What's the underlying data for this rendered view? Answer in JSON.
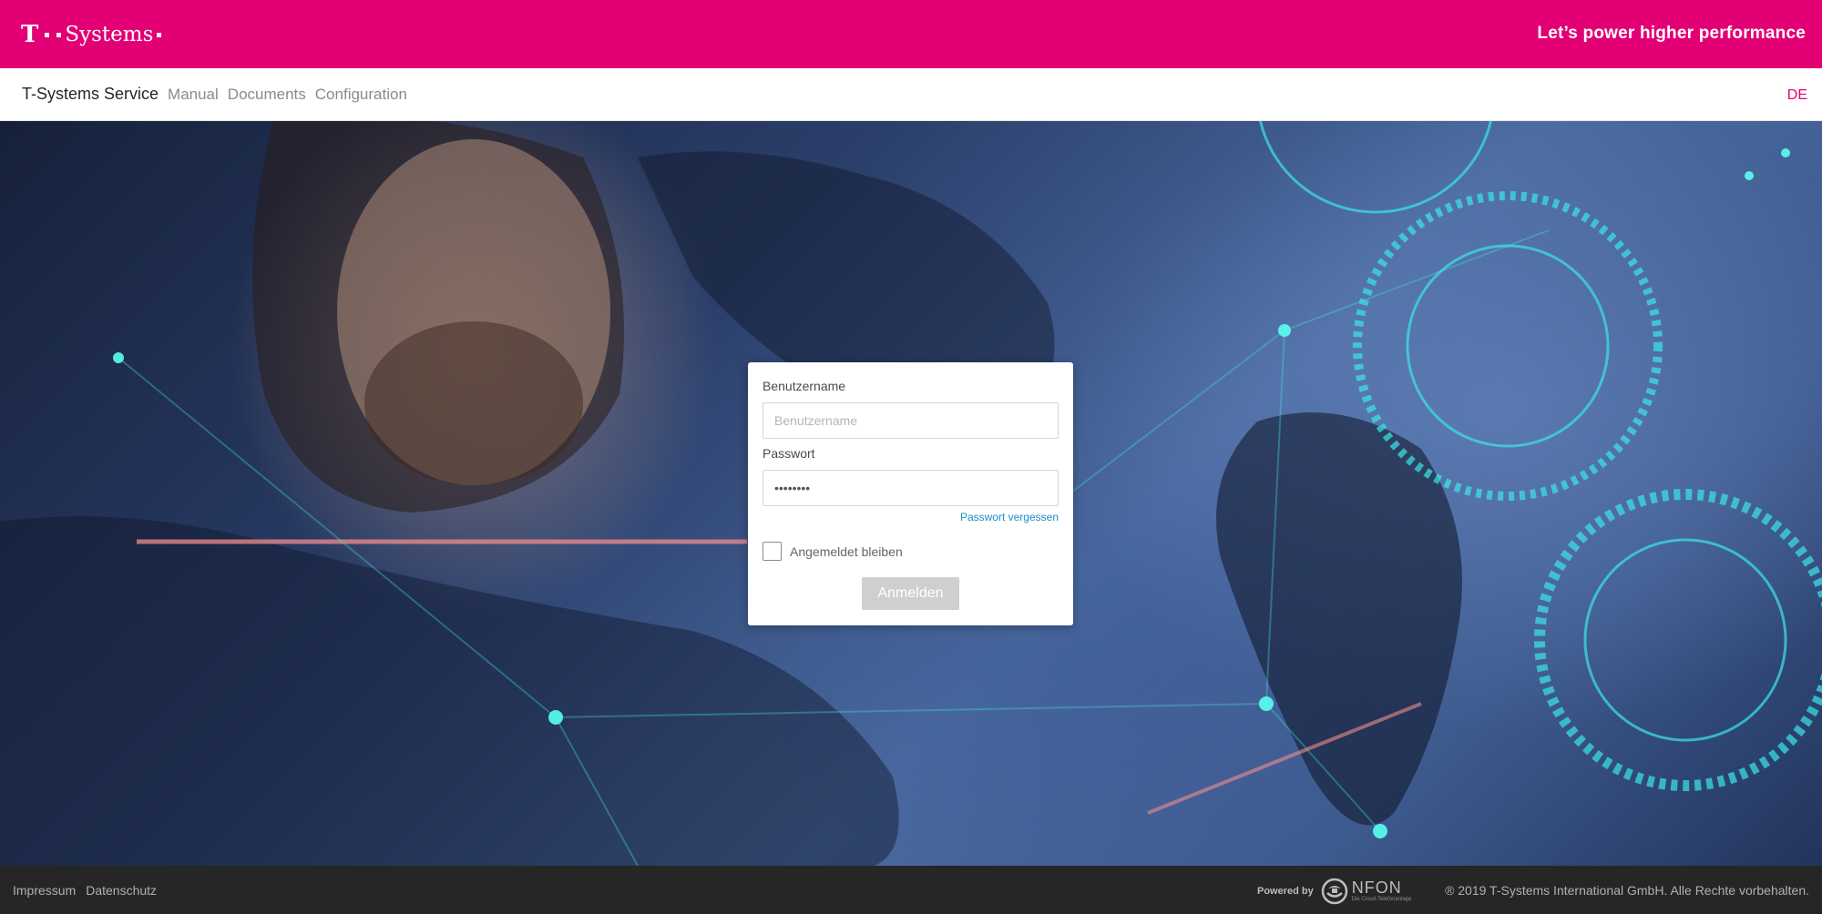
{
  "header": {
    "brand": "Systems",
    "brand_mark": "T",
    "slogan": "Let’s power higher performance",
    "brand_color": "#e20074"
  },
  "nav": {
    "home": "T-Systems Service",
    "items": [
      {
        "label": "Manual"
      },
      {
        "label": "Documents"
      },
      {
        "label": "Configuration"
      }
    ],
    "language": "DE"
  },
  "login": {
    "username_label": "Benutzername",
    "username_placeholder": "Benutzername",
    "username_value": "",
    "password_label": "Passwort",
    "password_value": "••••••••",
    "forgot_password": "Passwort vergessen",
    "remember_label": "Angemeldet bleiben",
    "remember_checked": false,
    "submit_label": "Anmelden"
  },
  "footer": {
    "links": [
      {
        "label": "Impressum"
      },
      {
        "label": "Datenschutz"
      }
    ],
    "powered_by": "Powered by",
    "powered_brand": "NFON",
    "powered_tagline": "Die Cloud-Telefonanlage",
    "copyright": "® 2019 T-Systems International GmbH. Alle Rechte vorbehalten."
  }
}
